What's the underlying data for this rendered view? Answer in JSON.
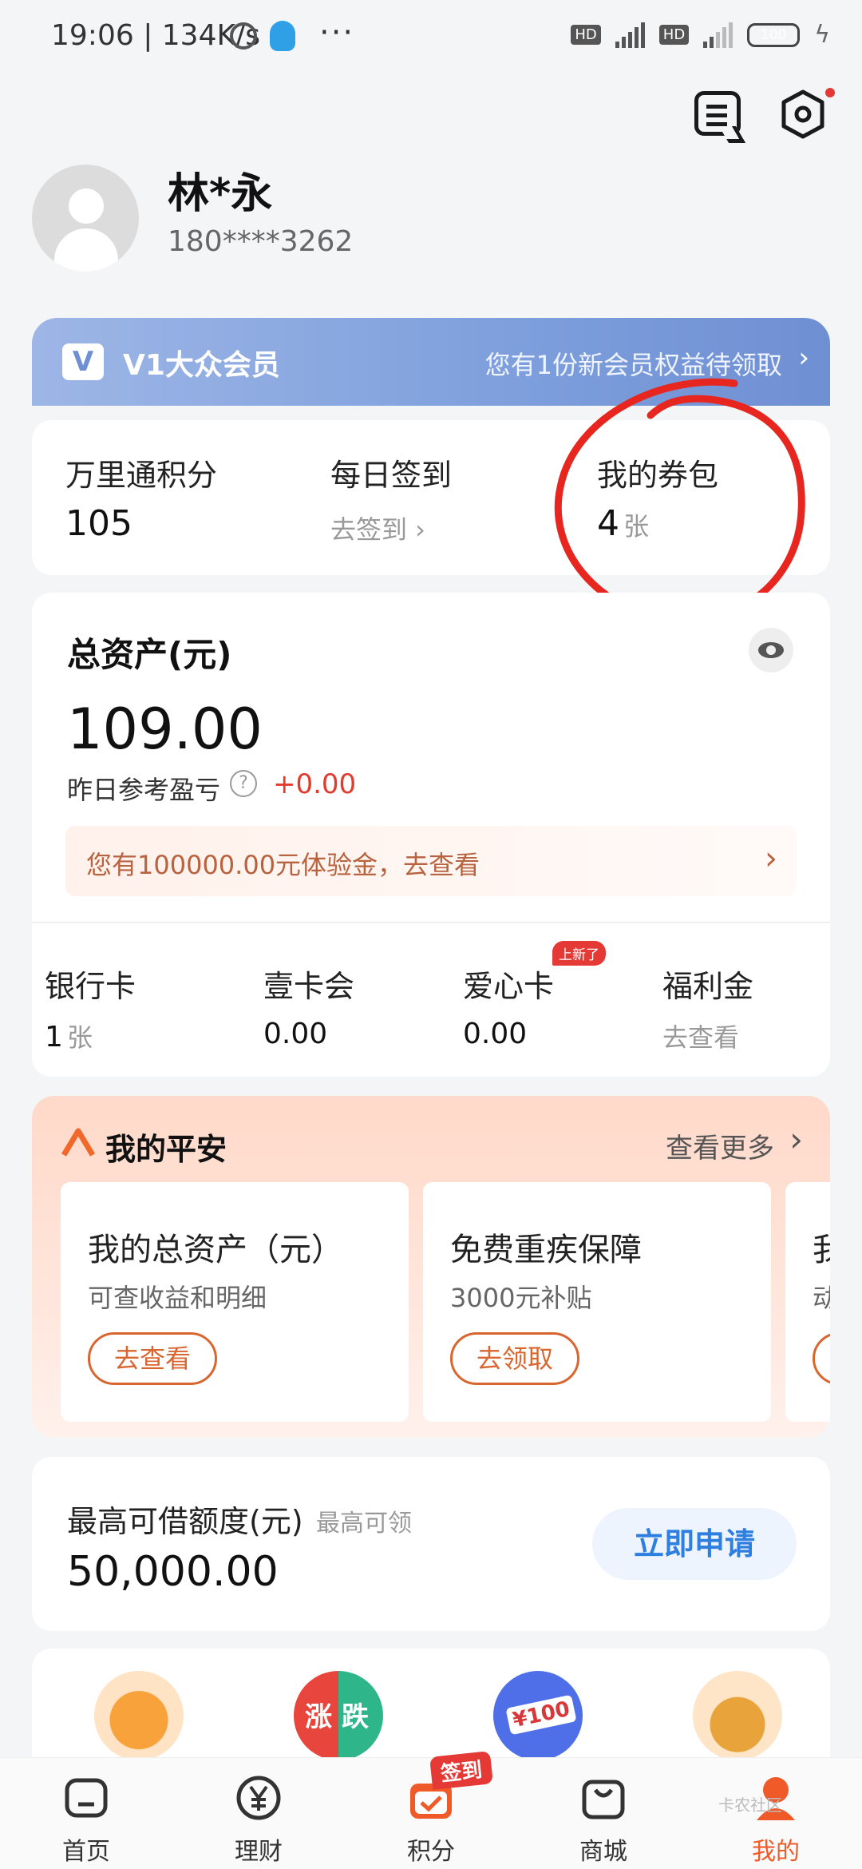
{
  "status_bar": {
    "time_speed": "19:06 | 134K/s",
    "more": "···",
    "hd1": "HD",
    "hd2": "HD",
    "net1": "4G",
    "net2": "4G",
    "battery": "100"
  },
  "header": {
    "message_icon": "message-square-icon",
    "settings_icon": "hexagon-settings-icon"
  },
  "profile": {
    "name": "林*永",
    "phone": "180****3262"
  },
  "membership": {
    "logo": "V",
    "level": "V1大众会员",
    "promo": "您有1份新会员权益待领取",
    "arrow": "›"
  },
  "stats": {
    "points_label": "万里通积分",
    "points_value": "105",
    "checkin_label": "每日签到",
    "checkin_action": "去签到 ›",
    "coupon_label": "我的券包",
    "coupon_value": "4",
    "coupon_unit": "张"
  },
  "assets": {
    "title": "总资产(元)",
    "amount": "109.00",
    "pnl_label": "昨日参考盈亏",
    "help": "?",
    "pnl_value": "+0.00",
    "trial_text": "您有100000.00元体验金，去查看",
    "trial_arrow": "›",
    "items": [
      {
        "title": "银行卡",
        "value": "1",
        "unit": "张"
      },
      {
        "title": "壹卡会",
        "value": "0.00"
      },
      {
        "title": "爱心卡",
        "value": "0.00",
        "badge": "上新了"
      },
      {
        "title": "福利金",
        "sub": "去查看"
      }
    ]
  },
  "pingan": {
    "title": "我的平安",
    "more": "查看更多",
    "arrow": "›",
    "cards": [
      {
        "title": "我的总资产（元）",
        "desc": "可查收益和明细",
        "button": "去查看"
      },
      {
        "title": "免费重疾保障",
        "desc": "3000元补贴",
        "button": "去领取"
      },
      {
        "title": "我",
        "desc": "动",
        "button": ""
      }
    ]
  },
  "loan": {
    "title": "最高可借额度(元)",
    "subtitle": "最高可领",
    "amount": "50,000.00",
    "button": "立即申请"
  },
  "services": {
    "icons": [
      "shopping-bag-icon",
      "rise-fall-icon",
      "coupon-100-icon",
      "treasure-chest-icon"
    ],
    "rise": "涨",
    "fall": "跌",
    "coupon": "¥100"
  },
  "bottom_nav": {
    "items": [
      {
        "label": "首页",
        "icon": "home-icon"
      },
      {
        "label": "理财",
        "icon": "yuan-icon"
      },
      {
        "label": "积分",
        "icon": "calendar-check-icon"
      },
      {
        "label": "商城",
        "icon": "bag-icon"
      },
      {
        "label": "我的",
        "icon": "user-icon"
      }
    ],
    "signin_tag": "签到",
    "watermark": "卡农社区"
  },
  "colors": {
    "accent_orange": "#d9652f",
    "loss_red": "#e23b2e",
    "primary_blue": "#2f7fe0",
    "member_blue": "#7e9fdc",
    "annotation_red": "#e6261f"
  }
}
